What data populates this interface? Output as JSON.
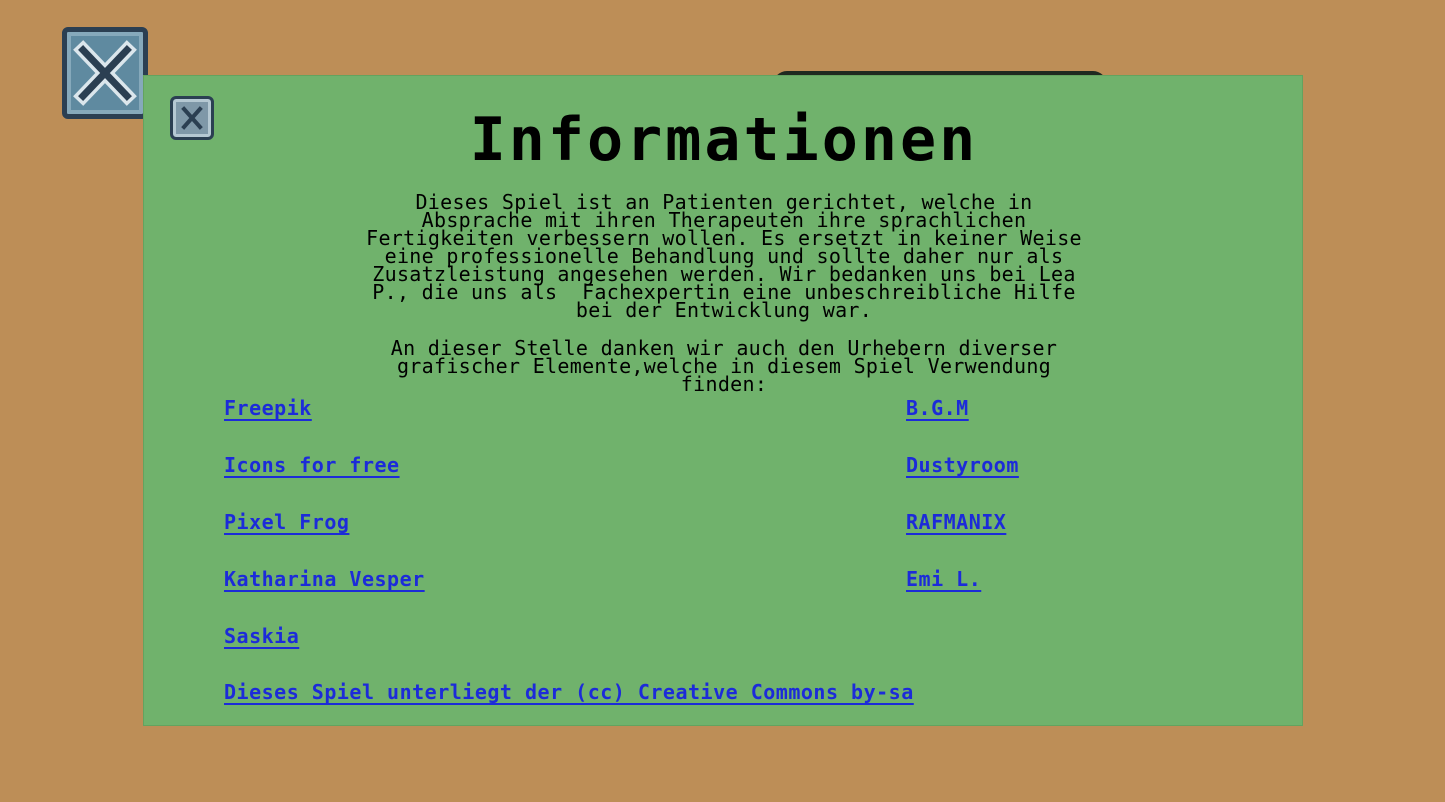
{
  "icons": {
    "background_close": "close-icon",
    "panel_close": "close-icon"
  },
  "colors": {
    "background": "#bd8e57",
    "panel": "#70b26c",
    "link": "#1c2bd9"
  },
  "dialog": {
    "title": "Informationen",
    "paragraph1": [
      "Dieses Spiel ist an Patienten gerichtet, welche in",
      "Absprache mit ihren Therapeuten ihre sprachlichen",
      "Fertigkeiten verbessern wollen. Es ersetzt in keiner Weise",
      "eine professionelle Behandlung und sollte daher nur als",
      "Zusatzleistung angesehen werden. Wir bedanken uns bei Lea",
      "P., die uns als  Fachexpertin eine unbeschreibliche Hilfe",
      "bei der Entwicklung war."
    ],
    "paragraph2": [
      "An dieser Stelle danken wir auch den Urhebern diverser",
      "grafischer Elemente,welche in diesem Spiel Verwendung",
      "finden:"
    ],
    "credits_left": [
      "Freepik",
      "Icons for free",
      "Pixel Frog",
      "Katharina Vesper",
      "Saskia"
    ],
    "credits_right": [
      "B.G.M",
      "Dustyroom",
      "RAFMANIX",
      "Emi L."
    ],
    "license_link": "Dieses Spiel unterliegt der (cc) Creative Commons by-sa"
  }
}
